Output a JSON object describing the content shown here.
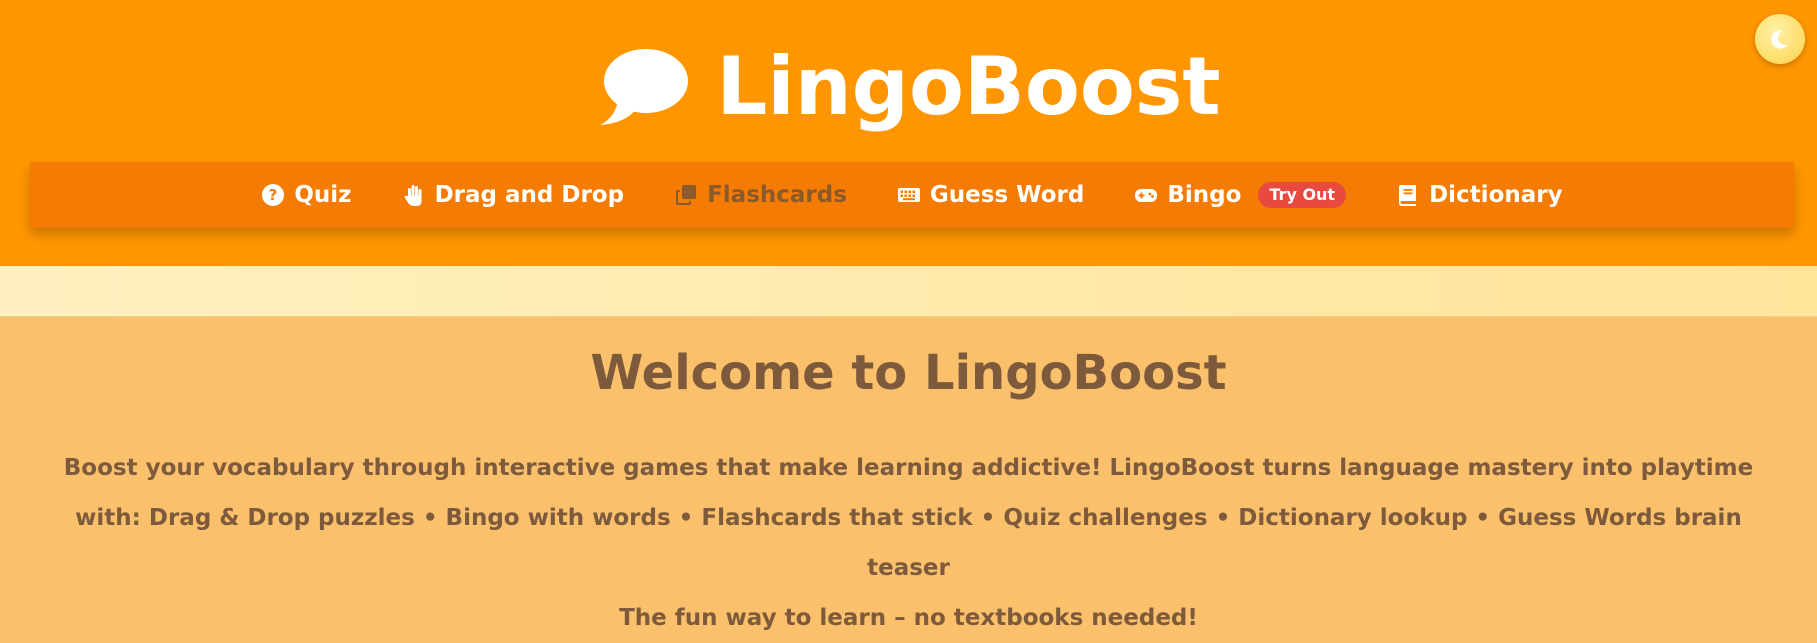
{
  "header": {
    "title": "LingoBoost",
    "logo_icon": "speech-bubble-icon",
    "theme_toggle_icon": "moon-icon"
  },
  "nav": {
    "items": [
      {
        "label": "Quiz",
        "icon": "question-circle-icon"
      },
      {
        "label": "Drag and Drop",
        "icon": "hand-icon"
      },
      {
        "label": "Flashcards",
        "icon": "clone-icon",
        "active": true
      },
      {
        "label": "Guess Word",
        "icon": "keyboard-icon"
      },
      {
        "label": "Bingo",
        "icon": "gamepad-icon",
        "badge": "Try Out"
      },
      {
        "label": "Dictionary",
        "icon": "book-icon"
      }
    ]
  },
  "main": {
    "heading": "Welcome to LingoBoost",
    "intro": "Boost your vocabulary through interactive games that make learning addictive! LingoBoost turns language mastery into playtime with: Drag & Drop puzzles • Bingo with words • Flashcards that stick • Quiz challenges • Dictionary lookup • Guess Words brain teaser",
    "tagline": "The fun way to learn – no textbooks needed!"
  },
  "colors": {
    "header_bg": "#ff9600",
    "nav_bg": "#f47b04",
    "content_bg": "#fbc06b",
    "text_brown": "#7d5a3b",
    "badge_red": "#e84a3f"
  }
}
